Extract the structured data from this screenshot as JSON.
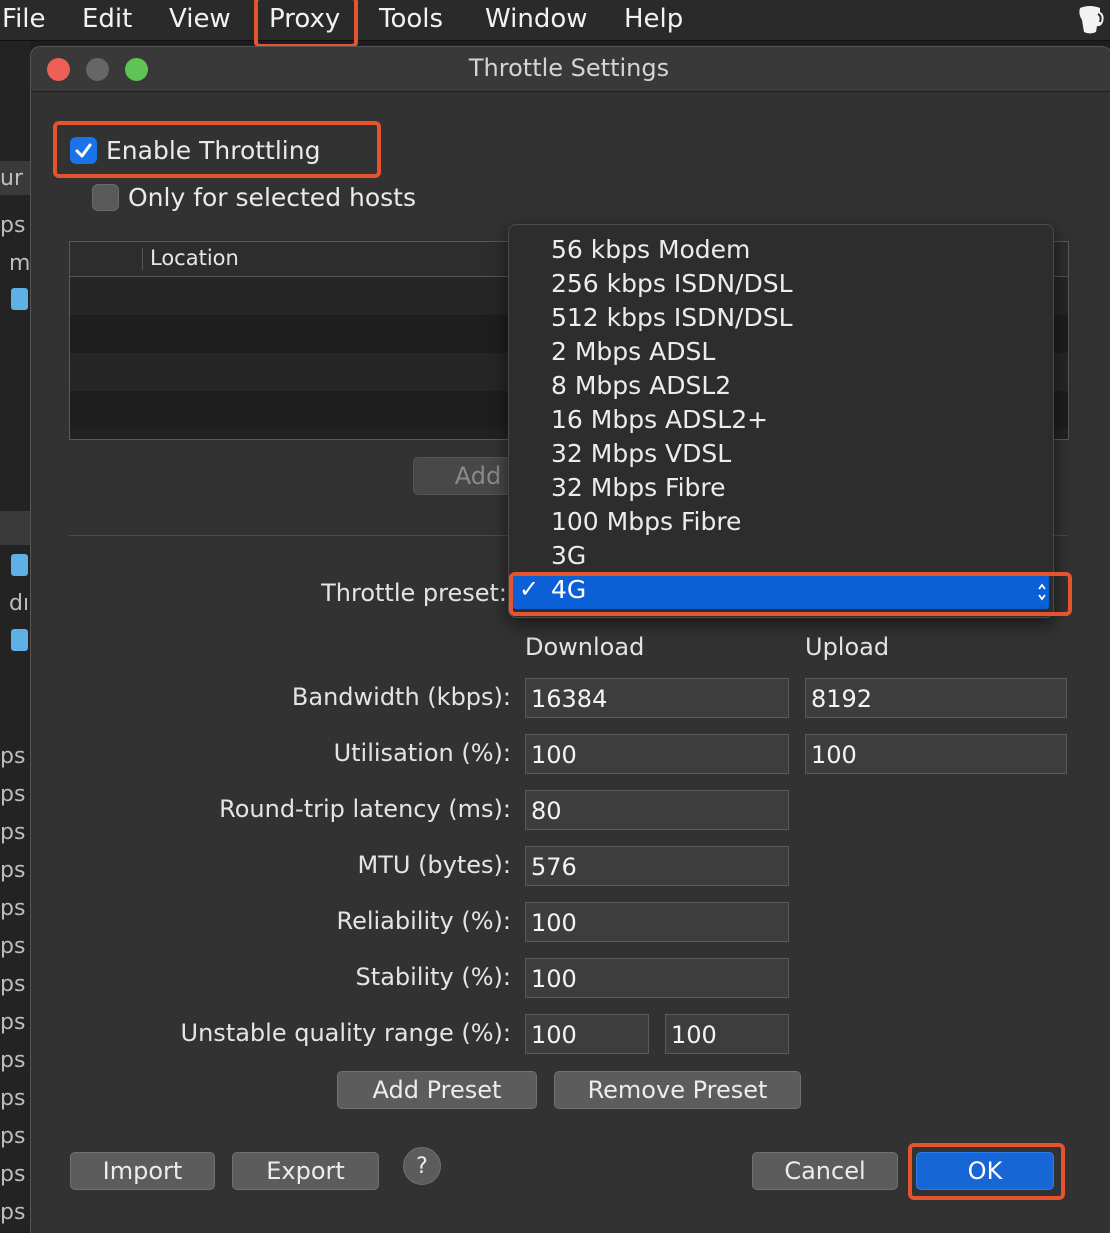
{
  "menubar": {
    "items": [
      "File",
      "Edit",
      "View",
      "Proxy",
      "Tools",
      "Window",
      "Help"
    ]
  },
  "background": {
    "fragments": [
      "ur",
      "ps",
      "m",
      "dı",
      "ps",
      "ps",
      "ps",
      "ps",
      "ps",
      "ps",
      "ps",
      "ps",
      "ps",
      "ps",
      "ps",
      "ps",
      "ps"
    ]
  },
  "dialog": {
    "title": "Throttle Settings",
    "enable_throttling": {
      "label": "Enable Throttling",
      "checked": true
    },
    "only_selected_hosts": {
      "label": "Only for selected hosts",
      "checked": false
    },
    "hosts_table": {
      "column": "Location"
    },
    "add_button": "Add",
    "preset_label": "Throttle preset:",
    "preset_options": [
      "56 kbps Modem",
      "256 kbps ISDN/DSL",
      "512 kbps ISDN/DSL",
      "2 Mbps ADSL",
      "8 Mbps ADSL2",
      "16 Mbps ADSL2+",
      "32 Mbps VDSL",
      "32 Mbps Fibre",
      "100 Mbps Fibre",
      "3G"
    ],
    "preset_selected": "4G",
    "preset_check": "✓",
    "columns": {
      "download": "Download",
      "upload": "Upload"
    },
    "fields": {
      "bandwidth": {
        "label": "Bandwidth (kbps):",
        "download": "16384",
        "upload": "8192"
      },
      "utilisation": {
        "label": "Utilisation (%):",
        "download": "100",
        "upload": "100"
      },
      "latency": {
        "label": "Round-trip latency (ms):",
        "value": "80"
      },
      "mtu": {
        "label": "MTU (bytes):",
        "value": "576"
      },
      "reliability": {
        "label": "Reliability (%):",
        "value": "100"
      },
      "stability": {
        "label": "Stability (%):",
        "value": "100"
      },
      "unstable_range": {
        "label": "Unstable quality range (%):",
        "min": "100",
        "max": "100"
      }
    },
    "buttons": {
      "add_preset": "Add Preset",
      "remove_preset": "Remove Preset",
      "import": "Import",
      "export": "Export",
      "help": "?",
      "cancel": "Cancel",
      "ok": "OK"
    }
  },
  "colors": {
    "accent": "#1766d6",
    "highlight_annotation": "#e4542e"
  }
}
